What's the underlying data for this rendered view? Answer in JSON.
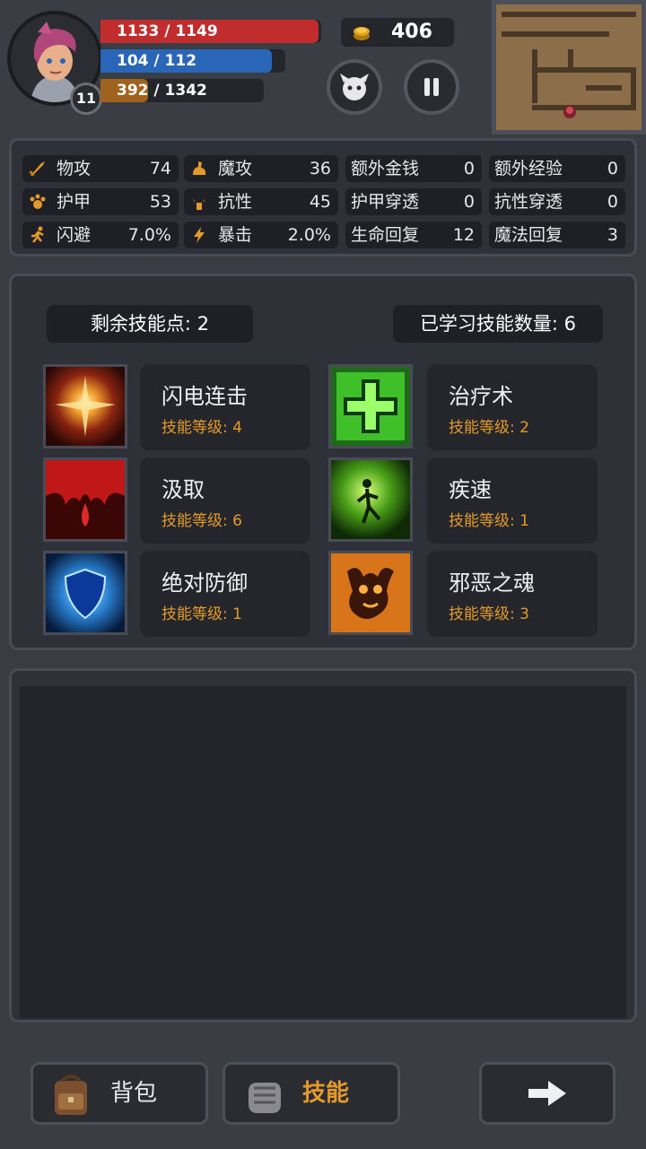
{
  "hud": {
    "hp": {
      "current": 1133,
      "max": 1149,
      "text": "1133 / 1149",
      "color": "#c12d2d"
    },
    "mp": {
      "current": 104,
      "max": 112,
      "text": "104 / 112",
      "color": "#2a66b8"
    },
    "xp": {
      "current": 392,
      "max": 1342,
      "text": "392 / 1342",
      "color": "#a0621f"
    },
    "level": "11",
    "gold": "406",
    "buttons": [
      {
        "icon": "monster-face-icon"
      },
      {
        "icon": "pause-icon"
      }
    ]
  },
  "stats": [
    [
      {
        "icon": "sword-icon",
        "label": "物攻",
        "value": "74"
      },
      {
        "icon": "magic-hand-icon",
        "label": "魔攻",
        "value": "36"
      },
      {
        "label": "额外金钱",
        "value": "0"
      },
      {
        "label": "额外经验",
        "value": "0"
      }
    ],
    [
      {
        "icon": "paw-armor-icon",
        "label": "护甲",
        "value": "53"
      },
      {
        "icon": "horns-icon",
        "label": "抗性",
        "value": "45"
      },
      {
        "label": "护甲穿透",
        "value": "0"
      },
      {
        "label": "抗性穿透",
        "value": "0"
      }
    ],
    [
      {
        "icon": "running-icon",
        "label": "闪避",
        "value": "7.0%"
      },
      {
        "icon": "lightning-icon",
        "label": "暴击",
        "value": "2.0%"
      },
      {
        "label": "生命回复",
        "value": "12"
      },
      {
        "label": "魔法回复",
        "value": "3"
      }
    ]
  ],
  "skills_header": {
    "remaining_points": "剩余技能点: 2",
    "learned_count": "已学习技能数量: 6"
  },
  "skills": [
    {
      "name": "闪电连击",
      "level": "技能等级: 4",
      "icon": "lightning-burst-icon"
    },
    {
      "name": "治疗术",
      "level": "技能等级: 2",
      "icon": "green-cross-icon"
    },
    {
      "name": "汲取",
      "level": "技能等级: 6",
      "icon": "blood-drain-icon"
    },
    {
      "name": "疾速",
      "level": "技能等级: 1",
      "icon": "haste-figure-icon"
    },
    {
      "name": "绝对防御",
      "level": "技能等级: 1",
      "icon": "blue-shield-icon"
    },
    {
      "name": "邪恶之魂",
      "level": "技能等级: 3",
      "icon": "evil-spirit-icon"
    }
  ],
  "nav": {
    "bag": "背包",
    "skills": "技能",
    "next_icon": "arrow-right-icon",
    "accent": "#e39a2a"
  }
}
